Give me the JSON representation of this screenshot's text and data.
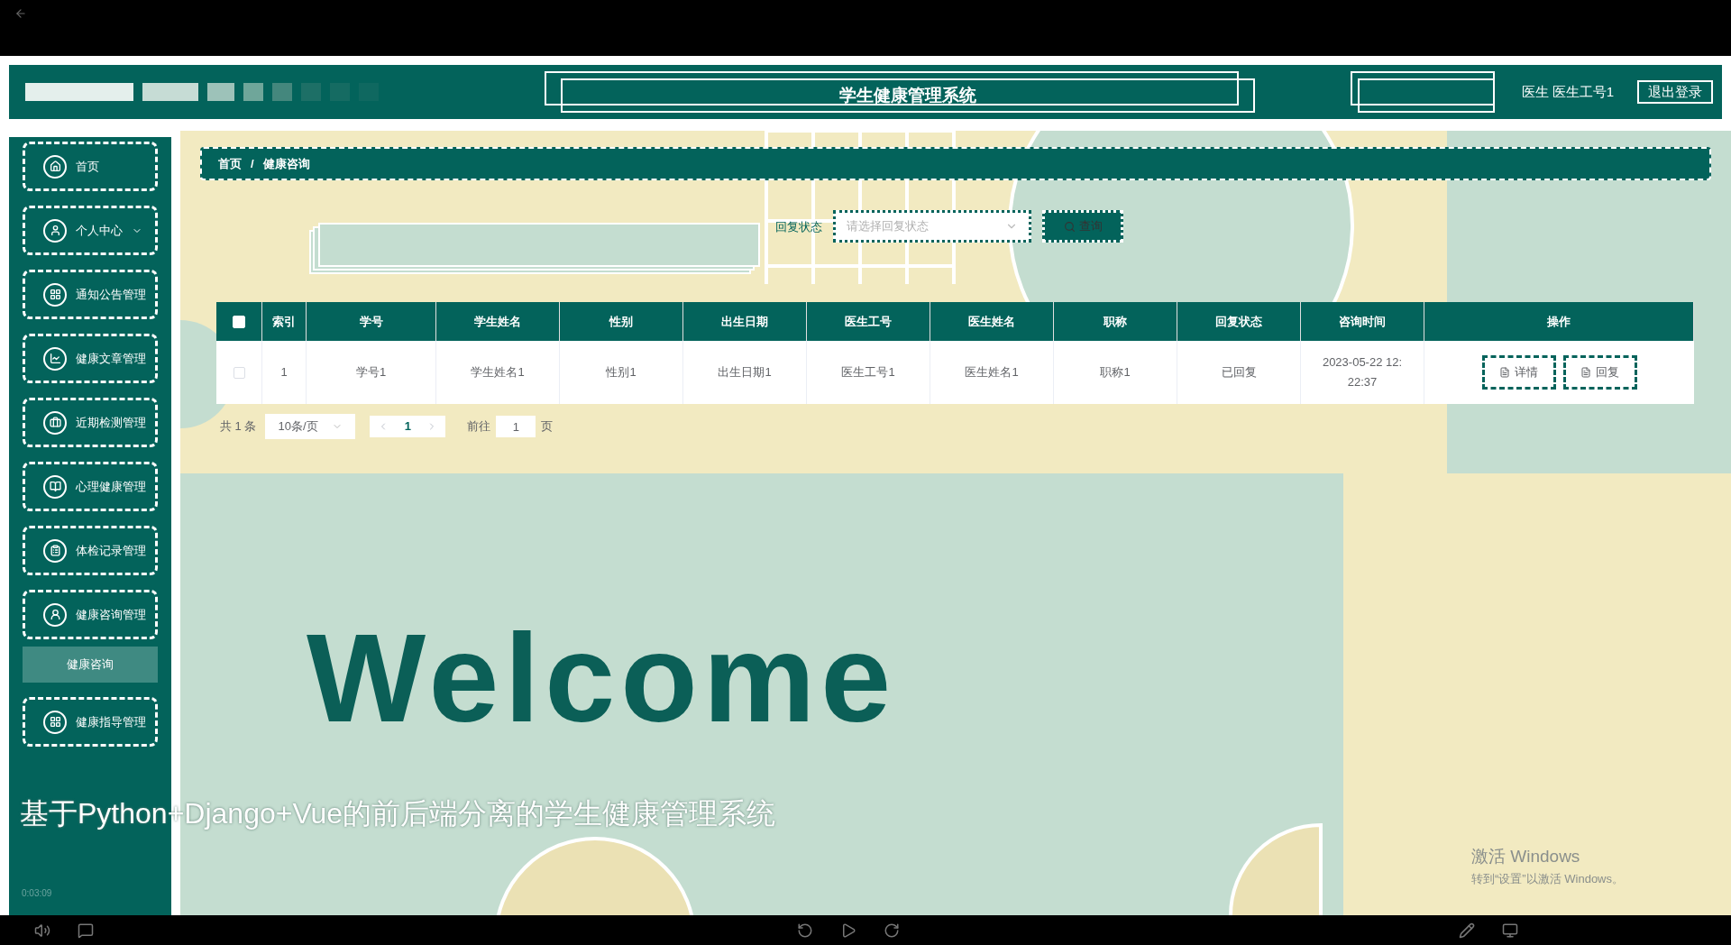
{
  "header": {
    "title": "学生健康管理系统",
    "role": "医生",
    "user": "医生工号1",
    "logout": "退出登录"
  },
  "sidebar": {
    "items": [
      {
        "label": "首页"
      },
      {
        "label": "个人中心",
        "expanded": false
      },
      {
        "label": "通知公告管理"
      },
      {
        "label": "健康文章管理"
      },
      {
        "label": "近期检测管理"
      },
      {
        "label": "心理健康管理"
      },
      {
        "label": "体检记录管理"
      },
      {
        "label": "健康咨询管理",
        "expanded": true,
        "children": [
          {
            "label": "健康咨询",
            "selected": true
          }
        ]
      },
      {
        "label": "健康指导管理"
      }
    ]
  },
  "breadcrumb": {
    "items": [
      "首页",
      "健康咨询"
    ],
    "separator": "/"
  },
  "search": {
    "label": "回复状态",
    "placeholder": "请选择回复状态",
    "button": "查询"
  },
  "table": {
    "select_all": false,
    "columns": [
      "索引",
      "学号",
      "学生姓名",
      "性别",
      "出生日期",
      "医生工号",
      "医生姓名",
      "职称",
      "回复状态",
      "咨询时间",
      "操作"
    ],
    "rows": [
      {
        "selected": false,
        "cells": [
          "1",
          "学号1",
          "学生姓名1",
          "性别1",
          "出生日期1",
          "医生工号1",
          "医生姓名1",
          "职称1",
          "已回复",
          "2023-05-22 12:22:37"
        ],
        "actions": [
          "详情",
          "回复"
        ]
      }
    ]
  },
  "pagination": {
    "total": "共 1 条",
    "page_size": "10条/页",
    "current": "1",
    "goto_label": "前往",
    "goto_value": "1",
    "goto_suffix": "页"
  },
  "welcome": "Welcome",
  "video": {
    "caption": "基于Python+Django+Vue的前后端分离的学生健康管理系统",
    "time": "0:03:09"
  },
  "os_watermark": {
    "title": "激活 Windows",
    "subtitle": "转到“设置”以激活 Windows。"
  }
}
